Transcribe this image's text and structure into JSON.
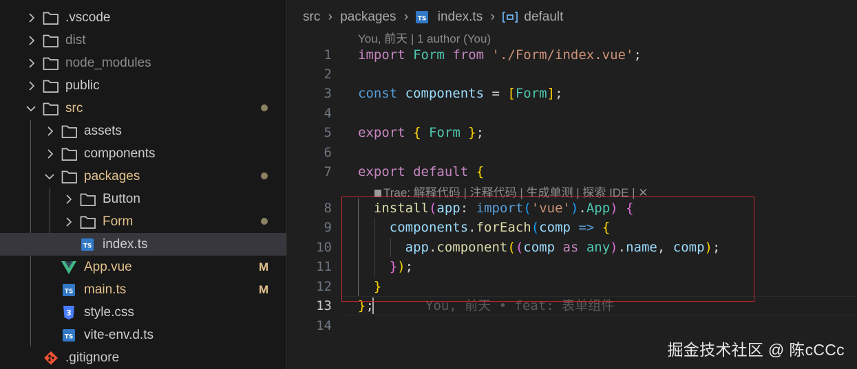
{
  "explorer": {
    "items": [
      {
        "label": ".vscode",
        "icon": "folder-icon",
        "expanded": false
      },
      {
        "label": "dist",
        "icon": "folder-icon",
        "expanded": false
      },
      {
        "label": "node_modules",
        "icon": "folder-icon",
        "expanded": false
      },
      {
        "label": "public",
        "icon": "folder-icon",
        "expanded": false
      },
      {
        "label": "src",
        "icon": "folder-icon",
        "expanded": true,
        "status": "modified-dot"
      },
      {
        "label": "assets",
        "icon": "folder-icon",
        "expanded": false
      },
      {
        "label": "components",
        "icon": "folder-icon",
        "expanded": false
      },
      {
        "label": "packages",
        "icon": "folder-icon",
        "expanded": true,
        "status": "modified-dot"
      },
      {
        "label": "Button",
        "icon": "folder-icon",
        "expanded": false
      },
      {
        "label": "Form",
        "icon": "folder-icon",
        "expanded": false,
        "status": "modified-dot"
      },
      {
        "label": "index.ts",
        "icon": "typescript-file-icon",
        "selected": true
      },
      {
        "label": "App.vue",
        "icon": "vue-file-icon",
        "badge": "M"
      },
      {
        "label": "main.ts",
        "icon": "typescript-file-icon",
        "badge": "M"
      },
      {
        "label": "style.css",
        "icon": "css-file-icon"
      },
      {
        "label": "vite-env.d.ts",
        "icon": "typescript-file-icon"
      },
      {
        "label": ".gitignore",
        "icon": "git-file-icon"
      }
    ]
  },
  "editor": {
    "breadcrumb": [
      "src",
      "packages",
      "index.ts",
      "default"
    ],
    "blame_header": "You, 前天 | 1 author (You)",
    "codelens": "Trae: 解释代码 | 注释代码 | 生成单测 | 探索 IDE | ✕",
    "line_numbers": [
      "1",
      "2",
      "3",
      "4",
      "5",
      "6",
      "7",
      "8",
      "9",
      "10",
      "11",
      "12",
      "13",
      "14"
    ],
    "active_line": "13",
    "inline_blame": "You, 前天 • feat: 表单组件",
    "code_lines": [
      "import Form from './Form/index.vue';",
      "",
      "const components = [Form];",
      "",
      "export { Form };",
      "",
      "export default {",
      "  install(app: import('vue').App) {",
      "    components.forEach(comp => {",
      "      app.component((comp as any).name, comp);",
      "    });",
      "  }",
      "};",
      ""
    ]
  },
  "watermark": "掘金技术社区 @ 陈cCCc",
  "colors": {
    "keyword": "#c586c0",
    "storage": "#569cd6",
    "variable": "#9cdcfe",
    "type": "#4ec9b0",
    "string": "#ce9178",
    "function": "#dcdcaa",
    "highlight_box": "#c8282d"
  }
}
